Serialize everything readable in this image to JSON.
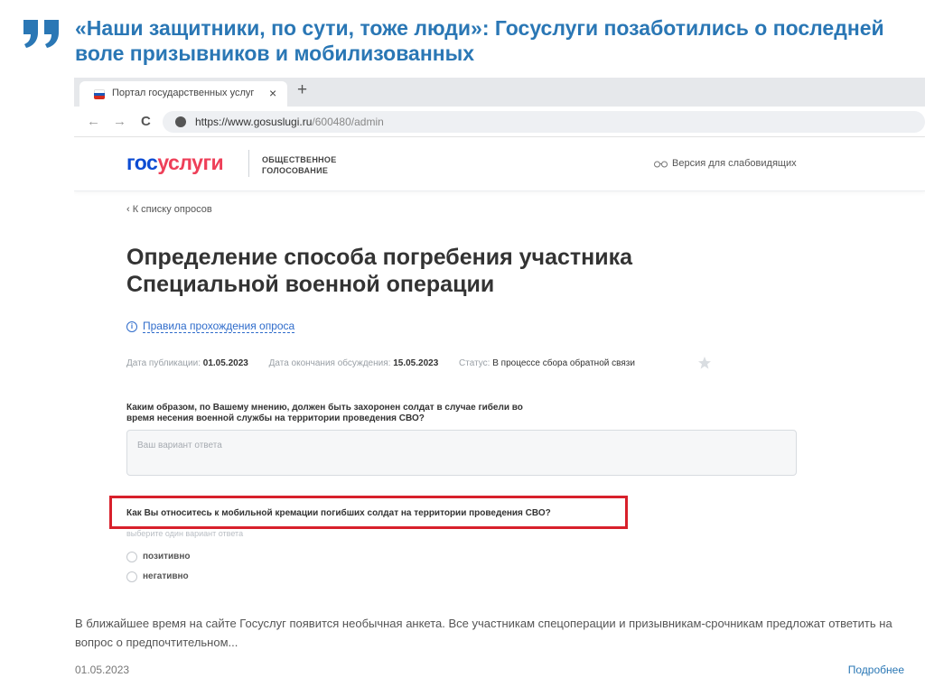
{
  "article": {
    "headline": "«Наши защитники, по сути, тоже люди»: Госуслуги позаботились о последней воле призывников и мобилизованных",
    "lead": "В ближайшее время на сайте Госуслуг появится необычная анкета. Все участникам спецоперации и призывникам-срочникам предложат ответить на вопрос о предпочтительном...",
    "date": "01.05.2023",
    "more_link": "Подробнее",
    "accent_color": "#2a77b5"
  },
  "browser": {
    "tab_title": "Портал государственных услуг Российской Федерации",
    "tab_close": "×",
    "new_tab": "+",
    "url_base": "https://www.gosuslugi.ru",
    "url_path": "/600480/admin",
    "nav": {
      "back": "←",
      "forward": "→",
      "reload": "C"
    }
  },
  "site": {
    "logo_part1": "гос",
    "logo_part2": "услуги",
    "subtitle": "ОБЩЕСТВЕННОЕ ГОЛОСОВАНИЕ",
    "vision_link": "Версия для слабовидящих",
    "brand_blue": "#0d4cd3",
    "brand_red": "#ee3f58"
  },
  "survey": {
    "back_link": "‹ К списку опросов",
    "title": "Определение способа погребения участника Специальной военной операции",
    "rules_link": "Правила прохождения опроса",
    "published_label": "Дата публикации:",
    "published_value": "01.05.2023",
    "ends_label": "Дата окончания обсуждения:",
    "ends_value": "15.05.2023",
    "status_label": "Статус:",
    "status_value": "В процессе сбора обратной связи",
    "question1": "Каким образом, по Вашему мнению, должен быть захоронен солдат в случае гибели во время несения военной службы на территории проведения СВО?",
    "answer_placeholder": "Ваш вариант ответа",
    "question2": "Как Вы относитесь к мобильной кремации погибших солдат на территории проведения СВО?",
    "hint": "выберите один вариант ответа",
    "options": [
      "позитивно",
      "негативно"
    ],
    "highlight_color": "#d8202b"
  }
}
